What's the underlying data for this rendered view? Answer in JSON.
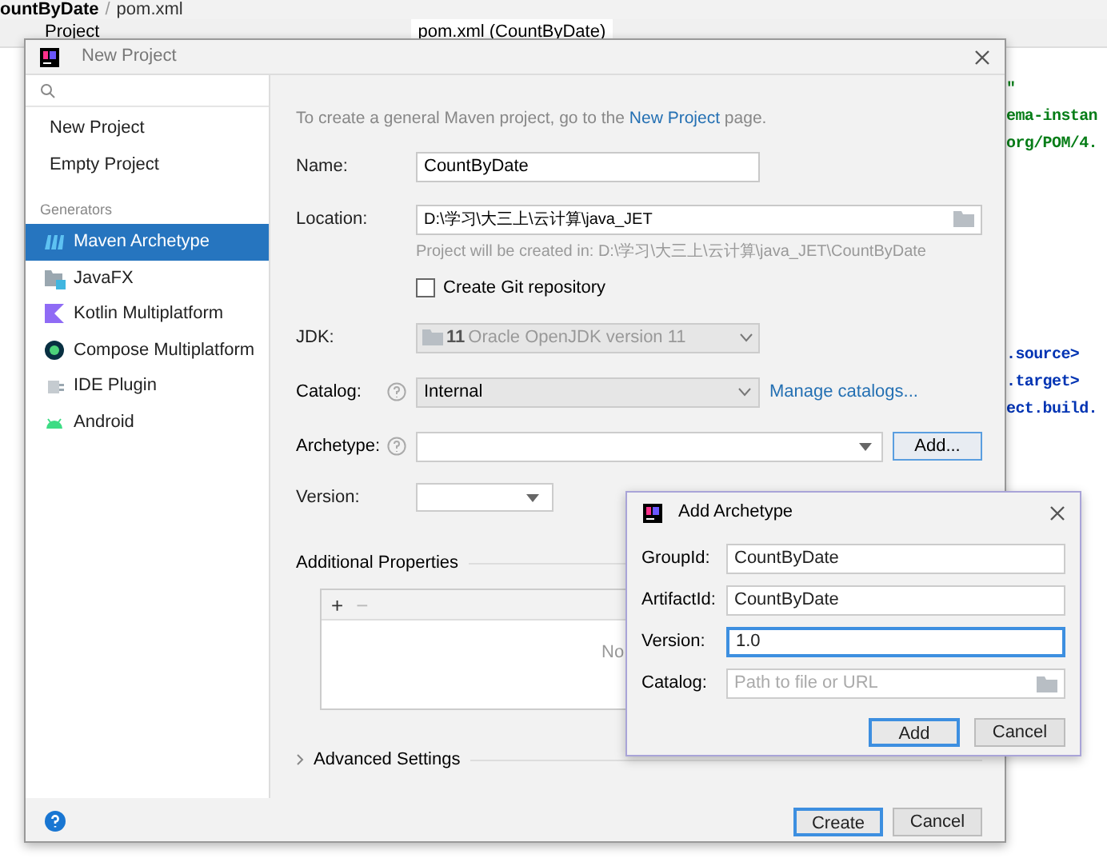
{
  "ide": {
    "breadcrumb": [
      "ountByDate",
      "pom.xml"
    ],
    "breadcrumb_separator": "/",
    "project_tool": "Project",
    "editor_tab": "pom.xml (CountByDate)",
    "code_blocks": [
      [
        {
          "text": "\"",
          "kind": "string"
        },
        {
          "text": "ema-instan",
          "kind": "string"
        },
        {
          "text": "org/POM/4.",
          "kind": "string"
        }
      ],
      [
        {
          "text": ".source>",
          "kind": "tag"
        },
        {
          "text": ".target>",
          "kind": "tag"
        },
        {
          "text": "ect.build.",
          "kind": "tag"
        }
      ]
    ]
  },
  "dialog": {
    "title": "New Project",
    "sidebar": {
      "items": [
        {
          "label": "New Project",
          "selected": false
        },
        {
          "label": "Empty Project",
          "selected": false
        }
      ],
      "section": "Generators",
      "generators": [
        {
          "label": "Maven Archetype",
          "kind": "maven",
          "selected": true
        },
        {
          "label": "JavaFX",
          "kind": "javafx",
          "selected": false
        },
        {
          "label": "Kotlin Multiplatform",
          "kind": "kotlin",
          "selected": false
        },
        {
          "label": "Compose Multiplatform",
          "kind": "compose",
          "selected": false
        },
        {
          "label": "IDE Plugin",
          "kind": "plugin",
          "selected": false
        },
        {
          "label": "Android",
          "kind": "android",
          "selected": false
        }
      ]
    },
    "intro": {
      "before": "To create a general Maven project, go to the",
      "link": "New Project",
      "after": "page."
    },
    "name": {
      "label": "Name:",
      "value": "CountByDate"
    },
    "location": {
      "label": "Location:",
      "value": "D:\\学习\\大三上\\云计算\\java_JET",
      "hint": "Project will be created in: D:\\学习\\大三上\\云计算\\java_JET\\CountByDate"
    },
    "git": {
      "label": "Create Git repository",
      "checked": false
    },
    "jdk": {
      "label": "JDK:",
      "version": "11",
      "value": "Oracle OpenJDK version 11",
      "disabled": true
    },
    "catalog": {
      "label": "Catalog:",
      "value": "Internal",
      "link": "Manage catalogs..."
    },
    "archetype": {
      "label": "Archetype:",
      "button": "Add..."
    },
    "version": {
      "label": "Version:"
    },
    "additional": {
      "title": "Additional Properties",
      "add": "+",
      "remove": "−",
      "empty": "No"
    },
    "advanced": {
      "label": "Advanced Settings",
      "expanded": false
    },
    "buttons": [
      {
        "label": "Create",
        "default": true
      },
      {
        "label": "Cancel",
        "default": false
      }
    ]
  },
  "add_dialog": {
    "title": "Add Archetype",
    "fields": [
      {
        "label": "GroupId:",
        "value": "CountByDate",
        "focused": false
      },
      {
        "label": "ArtifactId:",
        "value": "CountByDate",
        "focused": false
      },
      {
        "label": "Version:",
        "value": "1.0",
        "focused": true
      },
      {
        "label": "Catalog:",
        "placeholder": "Path to file or URL",
        "focused": false,
        "browse": true
      }
    ],
    "buttons": [
      {
        "label": "Add",
        "default": true
      },
      {
        "label": "Cancel",
        "default": false
      }
    ]
  }
}
